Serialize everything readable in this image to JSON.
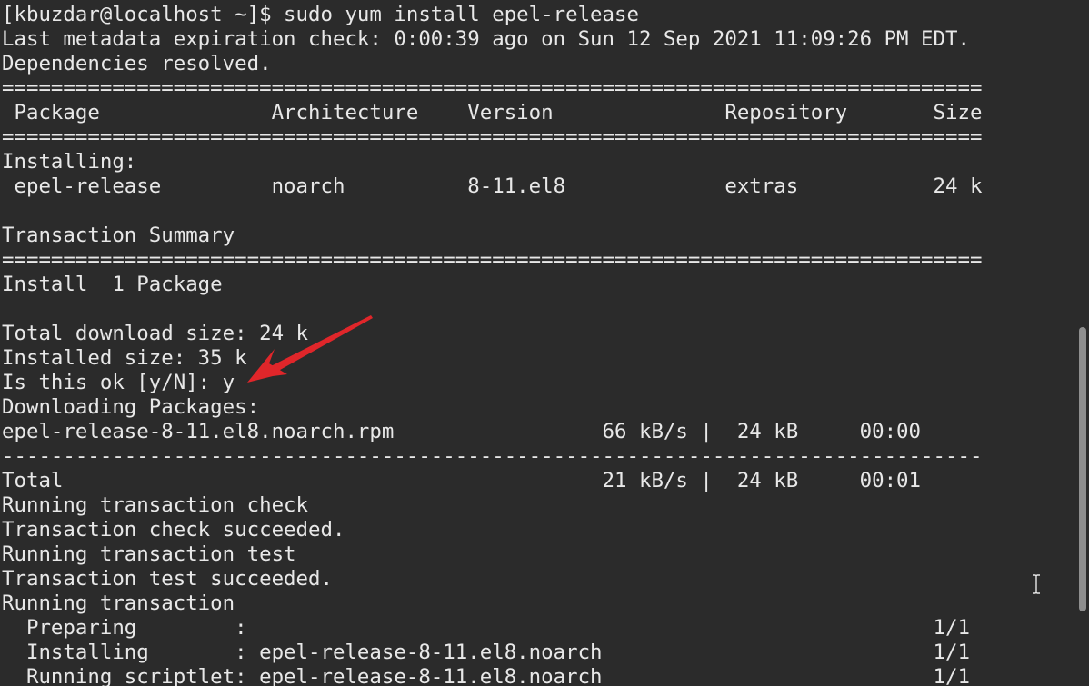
{
  "terminal": {
    "lines": [
      "[kbuzdar@localhost ~]$ sudo yum install epel-release",
      "Last metadata expiration check: 0:00:39 ago on Sun 12 Sep 2021 11:09:26 PM EDT.",
      "Dependencies resolved.",
      "================================================================================",
      " Package              Architecture    Version              Repository       Size",
      "================================================================================",
      "Installing:",
      " epel-release         noarch          8-11.el8             extras           24 k",
      "",
      "Transaction Summary",
      "================================================================================",
      "Install  1 Package",
      "",
      "Total download size: 24 k",
      "Installed size: 35 k",
      "Is this ok [y/N]: y",
      "Downloading Packages:",
      "epel-release-8-11.el8.noarch.rpm                 66 kB/s |  24 kB     00:00",
      "--------------------------------------------------------------------------------",
      "Total                                            21 kB/s |  24 kB     00:01",
      "Running transaction check",
      "Transaction check succeeded.",
      "Running transaction test",
      "Transaction test succeeded.",
      "Running transaction",
      "  Preparing        :                                                        1/1",
      "  Installing       : epel-release-8-11.el8.noarch                           1/1",
      "  Running scriptlet: epel-release-8-11.el8.noarch                           1/1"
    ]
  },
  "annotation": {
    "color": "#e0262a",
    "icon": "red-arrow-icon"
  },
  "scrollbar": {
    "thumb_color": "#8f8f8f"
  },
  "cursor": {
    "icon": "ibeam-cursor-icon"
  }
}
